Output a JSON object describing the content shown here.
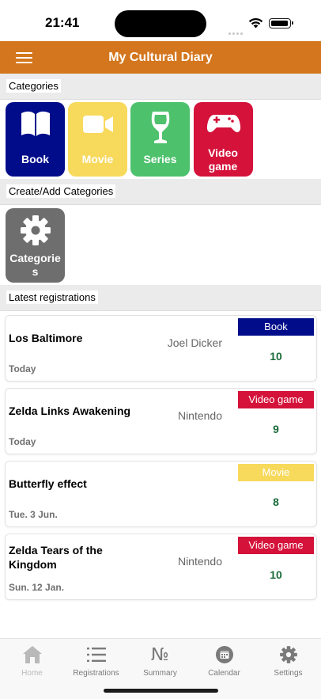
{
  "status": {
    "time": "21:41"
  },
  "header": {
    "title": "My Cultural Diary"
  },
  "sections": {
    "categories": "Categories",
    "create": "Create/Add Categories",
    "latest": "Latest registrations"
  },
  "categories": [
    {
      "label": "Book",
      "icon": "book-icon",
      "color": "#000c8a"
    },
    {
      "label": "Movie",
      "icon": "video-camera-icon",
      "color": "#f7d95c"
    },
    {
      "label": "Series",
      "icon": "wine-glass-icon",
      "color": "#4dc16c"
    },
    {
      "label": "Video game",
      "icon": "gamepad-icon",
      "color": "#d4123a"
    }
  ],
  "create_tile": {
    "label": "Categories",
    "icon": "gear-icon",
    "color": "#6e6e6e"
  },
  "registrations": [
    {
      "title": "Los Baltimore",
      "author": "Joel Dicker",
      "date": "Today",
      "category": "Book",
      "score": "10",
      "badge_color": "#000c8a"
    },
    {
      "title": "Zelda Links Awakening",
      "author": "Nintendo",
      "date": "Today",
      "category": "Video game",
      "score": "9",
      "badge_color": "#d4123a"
    },
    {
      "title": "Butterfly effect",
      "author": "",
      "date": "Tue. 3 Jun.",
      "category": "Movie",
      "score": "8",
      "badge_color": "#f7d95c"
    },
    {
      "title": "Zelda Tears of the Kingdom",
      "author": "Nintendo",
      "date": "Sun. 12 Jan.",
      "category": "Video game",
      "score": "10",
      "badge_color": "#d4123a"
    }
  ],
  "tabs": [
    {
      "label": "Home",
      "icon": "home-icon"
    },
    {
      "label": "Registrations",
      "icon": "list-icon"
    },
    {
      "label": "Summary",
      "icon": "numero-icon"
    },
    {
      "label": "Calendar",
      "icon": "calendar-icon"
    },
    {
      "label": "Settings",
      "icon": "gear-icon"
    }
  ]
}
